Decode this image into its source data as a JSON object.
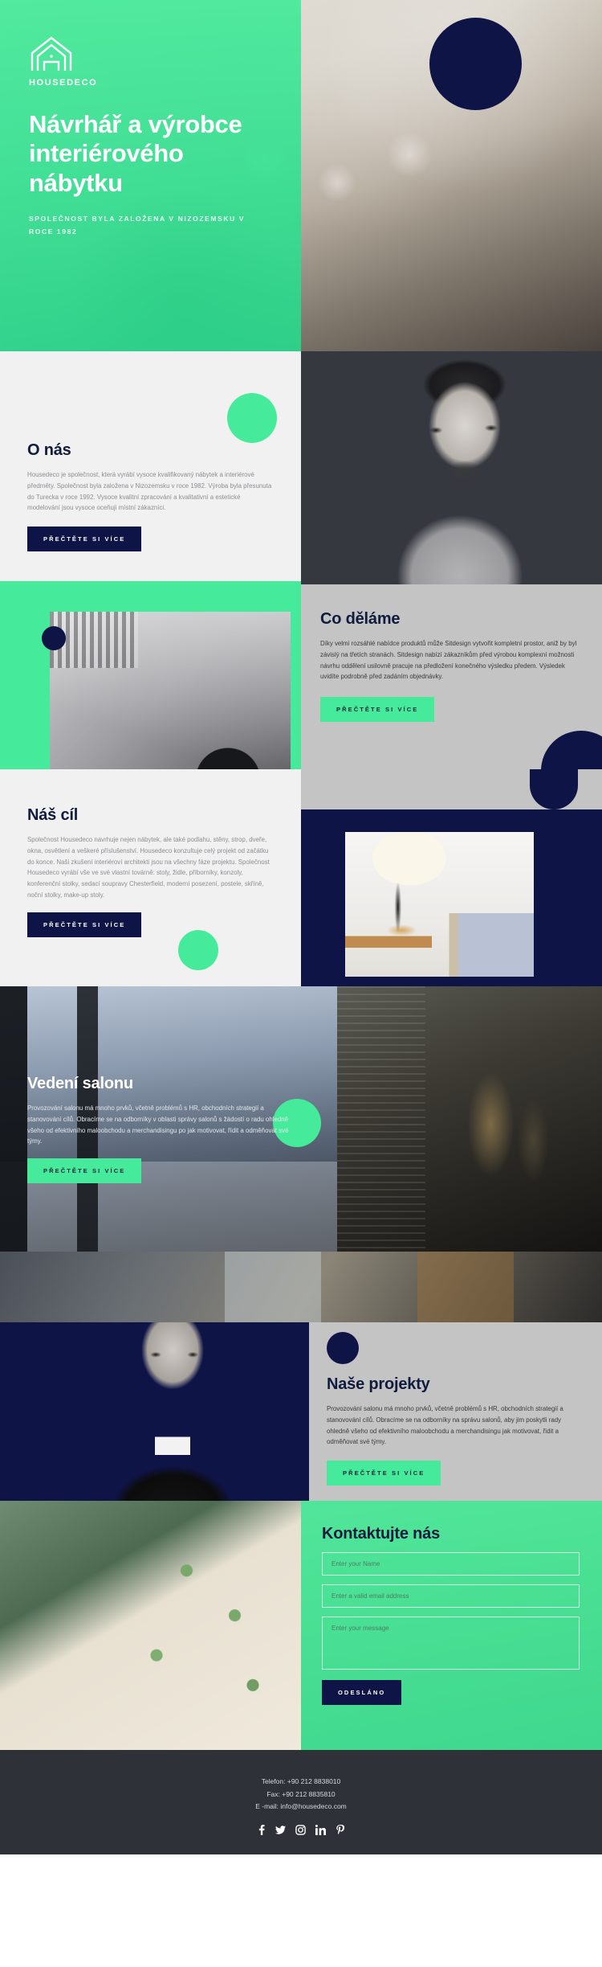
{
  "brand": {
    "name": "HOUSEDECO",
    "logo_icon": "house-outline-icon"
  },
  "colors": {
    "green": "#45eb9a",
    "navy": "#0f1446",
    "light": "#f1f1f1",
    "grey": "#c4c4c4",
    "footer": "#2e3138"
  },
  "hero": {
    "title": "Návrhář a výrobce interiérového nábytku",
    "subtitle": "SPOLEČNOST BYLA ZALOŽENA V NIZOZEMSKU V ROCE 1982"
  },
  "sections": [
    {
      "id": "about",
      "title": "O nás",
      "body": "Housedeco je společnost, která vyrábí vysoce kvalifikovaný nábytek a interiérové předměty. Společnost byla založena v Nizozemsku v roce 1982. Výroba byla přesunuta do Turecka v roce 1992. Vysoce kvalitní zpracování a kvalitativní a estetické modelování jsou vysoce oceňuji místní zákazníci.",
      "button": "PŘEČTĚTE SI VÍCE"
    },
    {
      "id": "what-we-do",
      "title": "Co děláme",
      "body": "Díky velmi rozsáhlé nabídce produktů může Sitdesign vytvořit kompletní prostor, aniž by byl závislý na třetích stranách. Sitdesign nabízí zákazníkům před výrobou komplexní možnosti návrhu oddělení usilovně pracuje na předložení konečného výsledku předem. Výsledek uvidíte podrobně před zadáním objednávky.",
      "button": "PŘEČTĚTE SI VÍCE"
    },
    {
      "id": "our-goal",
      "title": "Náš cíl",
      "body": "Společnost Housedeco navrhuje nejen nábytek, ale také podlahu, stěny, strop, dveře, okna, osvětlení a veškeré příslušenství. Housedeco konzultuje celý projekt od začátku do konce. Naši zkušení interiéroví architekti jsou na všechny fáze projektu. Společnost Housedeco vyrábí vše ve své vlastní továrně: stoly, židle, příborníky, konzoly, konferenční stolky, sedací soupravy Chesterfield, moderní posezení, postele, skříně, noční stolky, make-up stoly.",
      "button": "PŘEČTĚTE SI VÍCE"
    },
    {
      "id": "salon-management",
      "title": "Vedení salonu",
      "body": "Provozování salonu má mnoho prvků, včetně problémů s HR, obchodních strategií a stanovování cílů. Obracíme se na odborníky v oblasti správy salonů s žádostí o radu ohledně všeho od efektivního maloobchodu a merchandisingu po jak motivovat, řídit a odměňovat své týmy.",
      "button": "PŘEČTĚTE SI VÍCE"
    },
    {
      "id": "our-projects",
      "title": "Naše projekty",
      "body": "Provozování salonu má mnoho prvků, včetně problémů s HR, obchodních strategií a stanovování cílů. Obracíme se na odborníky na správu salonů, aby jim poskytli rady ohledně všeho od efektivního maloobchodu a merchandisingu jak motivovat, řídit a odměňovat své týmy.",
      "button": "PŘEČTĚTE SI VÍCE"
    }
  ],
  "contact": {
    "title": "Kontaktujte nás",
    "name_placeholder": "Enter your Name",
    "email_placeholder": "Enter a valid email address",
    "message_placeholder": "Enter your message",
    "submit_label": "ODESLÁNO"
  },
  "footer": {
    "phone": "Telefon: +90 212 8838010",
    "fax": "Fax: +90 212 8835810",
    "email": "E -mail: info@housedeco.com",
    "socials": [
      "facebook-icon",
      "twitter-icon",
      "instagram-icon",
      "linkedin-icon",
      "pinterest-icon"
    ]
  }
}
